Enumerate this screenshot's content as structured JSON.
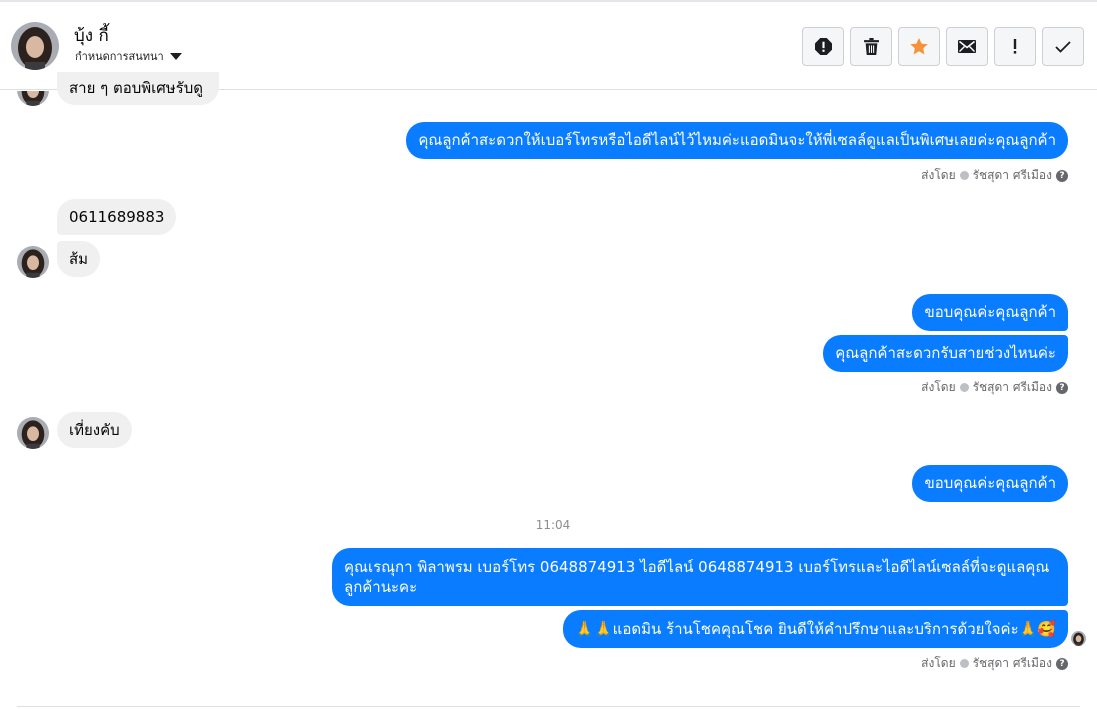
{
  "contact": {
    "name": "บุ้ง กี้",
    "assign_label": "กำหนดการสนทนา"
  },
  "toolbar": {
    "buttons": [
      "alert-icon",
      "trash-icon",
      "star-icon",
      "envelope-icon",
      "exclamation-icon",
      "check-icon"
    ],
    "star_color": "#f7923b"
  },
  "colors": {
    "outgoing_bubble": "#0a7cff",
    "incoming_bubble": "#f0f0f0"
  },
  "messages": {
    "m0_partial": "สาย ๆ ตอบพิเศษรับดู",
    "m1": "คุณลูกค้าสะดวกให้เบอร์โทรหรือไอดีไลน์ไว้ไหมค่ะแอดมินจะให้พี่เซลล์ดูแลเป็นพิเศษเลยค่ะคุณลูกค้า",
    "m2": "0611689883",
    "m3": "ส้ม",
    "m4": "ขอบคุณค่ะคุณลูกค้า",
    "m5": "คุณลูกค้าสะดวกรับสายช่วงไหนค่ะ",
    "m6": "เที่ยงคับ",
    "m7": "ขอบคุณค่ะคุณลูกค้า",
    "m8": "คุณเรณุกา พิลาพรม        เบอร์โทร 0648874913  ไอดีไลน์ 0648874913   เบอร์โทรและไอดีไลน์เซลล์ที่จะดูแลคุณลูกค้านะคะ",
    "m9": "🙏🙏แอดมิน ร้านโชคคุณโชค ยินดีให้คำปรึกษาและบริการด้วยใจค่ะ🙏🥰"
  },
  "sent_by": {
    "prefix": "ส่งโดย",
    "agent": "รัชสุดา ศรีเมือง"
  },
  "timestamp": "11:04"
}
